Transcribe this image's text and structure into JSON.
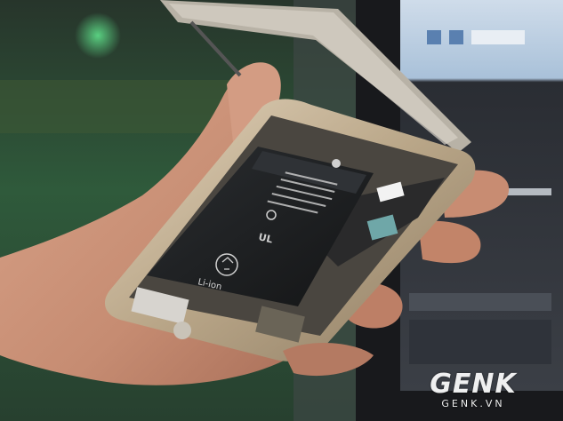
{
  "image": {
    "subject": "",
    "watermark": {
      "logo_text": "GENK",
      "domain_text": "GENK.VN"
    },
    "battery_label": {
      "logo": "apple-logo-icon",
      "recycle_mark": "recycle-icon",
      "chemistry": "Li-ion"
    },
    "colors": {
      "background_green": "#2d5a3c",
      "phone_frame_gold": "#c9b79b",
      "battery_black": "#1a1c1e",
      "skin": "#c9937a",
      "monitor_bezel": "#1b1c1f",
      "screen_blue": "#7fa6c8"
    }
  }
}
